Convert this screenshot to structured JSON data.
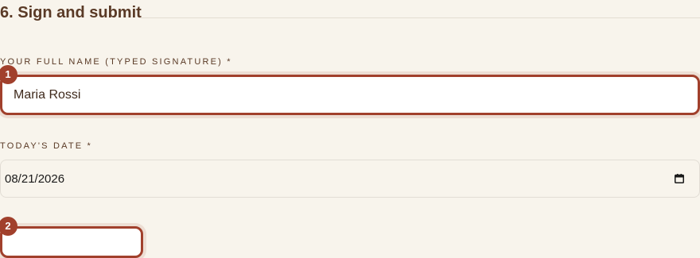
{
  "section": {
    "title": "6. Sign and submit"
  },
  "fields": {
    "full_name": {
      "label": "YOUR FULL NAME (TYPED SIGNATURE) *",
      "value": "Maria Rossi",
      "badge": "1"
    },
    "date": {
      "label": "TODAY'S DATE *",
      "value": "08/21/2026"
    },
    "next": {
      "badge": "2"
    }
  },
  "icons": {
    "calendar": "calendar-icon"
  },
  "colors": {
    "accent": "#a1402c",
    "background": "#f8f4ec",
    "text": "#5a3a26"
  }
}
